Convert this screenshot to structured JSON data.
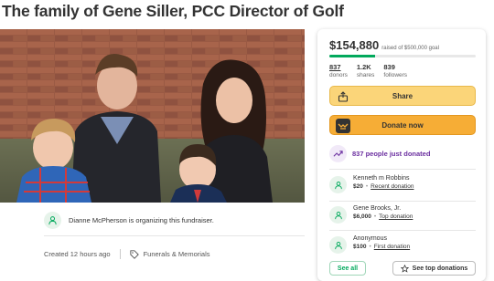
{
  "page": {
    "title": "The family of Gene Siller, PCC Director of Golf"
  },
  "organizer": {
    "text": "Dianne McPherson is organizing this fundraiser."
  },
  "meta": {
    "created": "Created 12 hours ago",
    "category": "Funerals & Memorials"
  },
  "donation_panel": {
    "raised_amount": "$154,880",
    "goal_text": "raised of $500,000 goal",
    "progress_fraction": 0.31,
    "stats": [
      {
        "value": "837",
        "label": "donors"
      },
      {
        "value": "1.2K",
        "label": "shares"
      },
      {
        "value": "839",
        "label": "followers"
      }
    ],
    "share_label": "Share",
    "donate_label": "Donate now",
    "recent_activity": "837 people just donated",
    "donors": [
      {
        "name": "Kenneth m Robbins",
        "amount": "$20",
        "tag": "Recent donation"
      },
      {
        "name": "Gene Brooks, Jr.",
        "amount": "$6,000",
        "tag": "Top donation"
      },
      {
        "name": "Anonymous",
        "amount": "$100",
        "tag": "First donation"
      }
    ],
    "see_all_label": "See all",
    "see_top_label": "See top donations"
  },
  "colors": {
    "brand_green": "#02a95c",
    "share_yellow": "#fbd579",
    "donate_orange": "#f6ad36",
    "activity_purple": "#6b2fa0"
  },
  "icons": {
    "organizer": "person-icon",
    "category": "tag-icon",
    "share": "share-icon",
    "donate": "hands-icon",
    "activity": "trending-up-icon",
    "donor": "donor-icon",
    "see_top": "star-icon"
  }
}
